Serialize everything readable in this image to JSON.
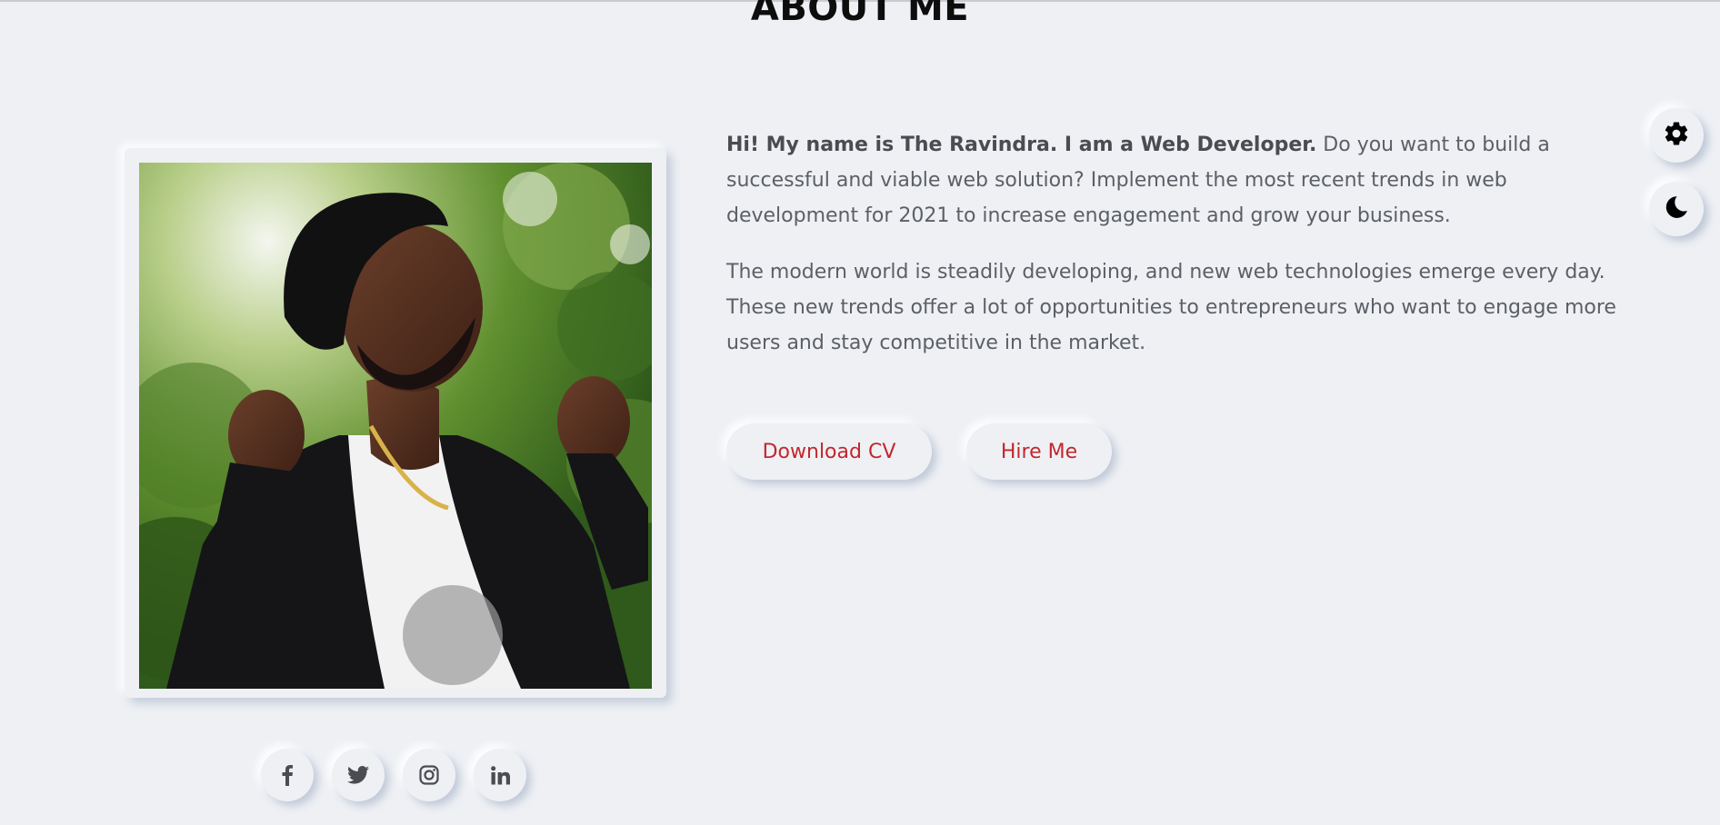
{
  "section": {
    "title": "ABOUT ME"
  },
  "about": {
    "intro_bold": "Hi! My name is The Ravindra. I am a Web Developer.",
    "intro_rest": " Do you want to build a successful and viable web solution? Implement the most recent trends in web development for 2021 to increase engagement and grow your business.",
    "paragraph2": "The modern world is steadily developing, and new web technologies emerge every day. These new trends offer a lot of opportunities to entrepreneurs who want to engage more users and stay competitive in the market."
  },
  "actions": {
    "download_cv": "Download CV",
    "hire_me": "Hire Me"
  },
  "social": [
    {
      "icon": "facebook-icon"
    },
    {
      "icon": "twitter-icon"
    },
    {
      "icon": "instagram-icon"
    },
    {
      "icon": "linkedin-icon"
    }
  ],
  "floating": {
    "settings_icon": "gear-icon",
    "theme_icon": "moon-icon"
  },
  "colors": {
    "background": "#eef0f4",
    "accent": "#c2272d",
    "body_text": "#5c5f66",
    "heading": "#0d0d0d"
  }
}
